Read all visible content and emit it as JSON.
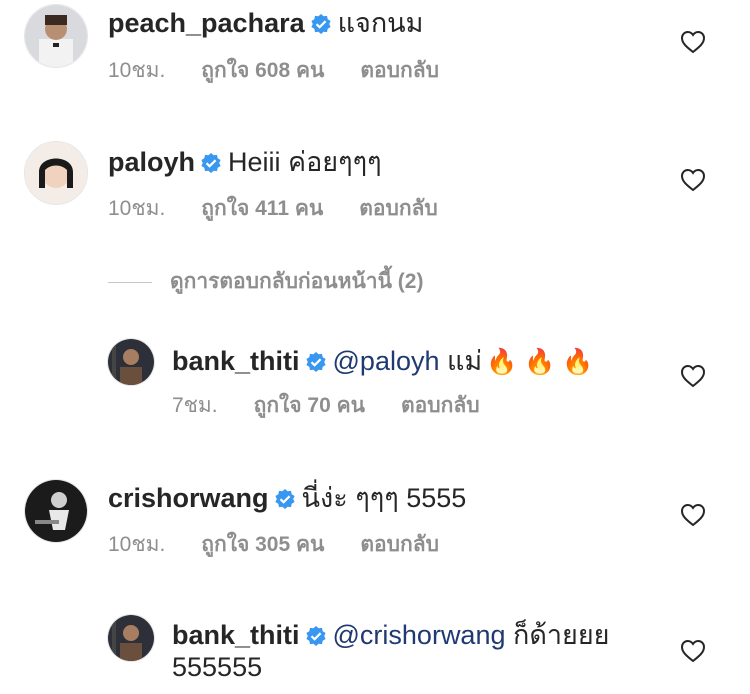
{
  "comments": [
    {
      "username": "peach_pachara",
      "text": "แจกนม",
      "time": "10ชม.",
      "likes": "ถูกใจ 608 คน",
      "reply": "ตอบกลับ",
      "avatar_icon": "profile-photo"
    },
    {
      "username": "paloyh",
      "text": "Heiii ค่อยๆๆๆ",
      "time": "10ชม.",
      "likes": "ถูกใจ 411 คน",
      "reply": "ตอบกลับ",
      "avatar_icon": "profile-photo"
    },
    {
      "username": "crishorwang",
      "text": "นี่ง่ะ ๆๆๆ 5555",
      "time": "10ชม.",
      "likes": "ถูกใจ 305 คน",
      "reply": "ตอบกลับ",
      "avatar_icon": "profile-photo"
    }
  ],
  "view_previous_replies": "ดูการตอบกลับก่อนหน้านี้ (2)",
  "replies": [
    {
      "username": "bank_thiti",
      "mention": "@paloyh",
      "text": "แม่",
      "emoji": "🔥 🔥 🔥",
      "time": "7ชม.",
      "likes": "ถูกใจ 70 คน",
      "reply": "ตอบกลับ"
    },
    {
      "username": "bank_thiti",
      "mention": "@crishorwang",
      "text": "ก็ด้ายยย",
      "text_line2": "555555"
    }
  ],
  "colors": {
    "verified_badge": "#3897f0",
    "mention": "#1f3a72",
    "meta": "#8e8e8e"
  },
  "icons": [
    "verified-badge-icon",
    "heart-icon"
  ]
}
